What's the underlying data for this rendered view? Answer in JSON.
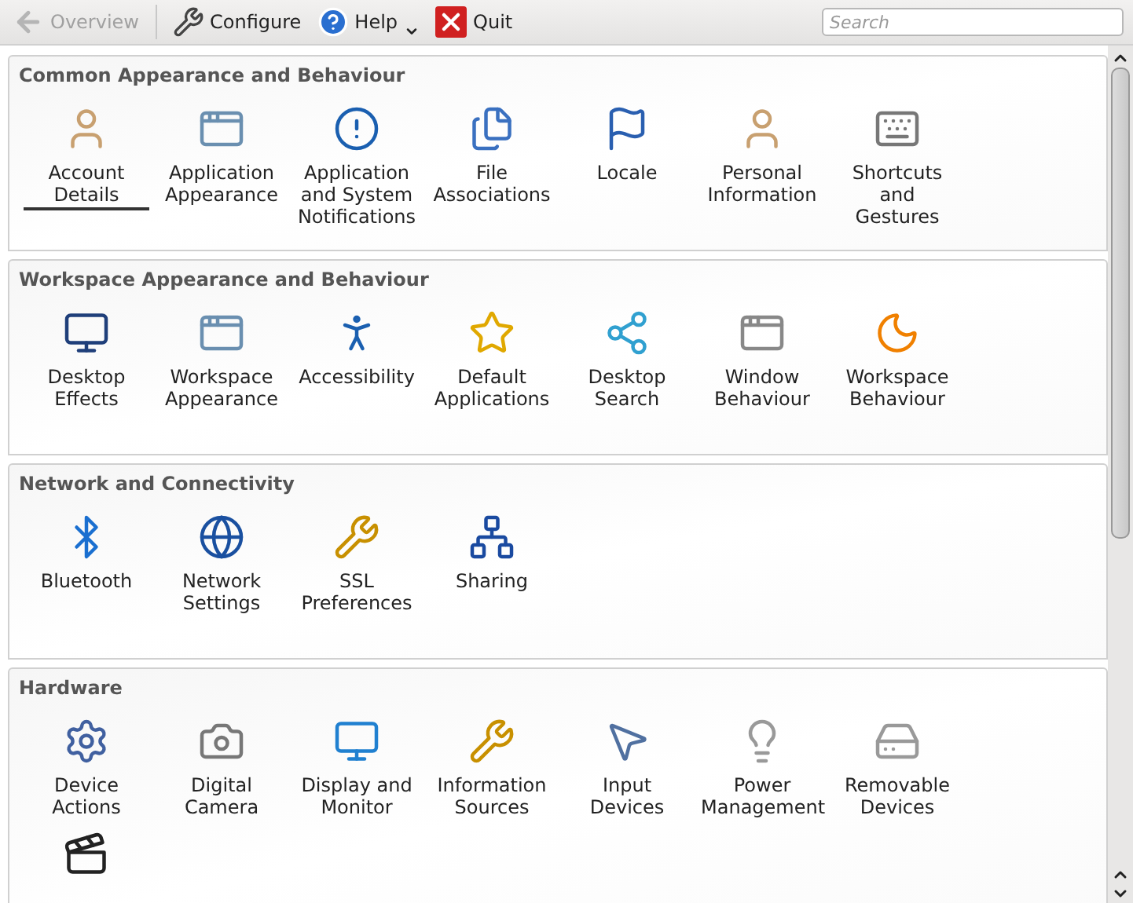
{
  "toolbar": {
    "overview": {
      "label": "Overview",
      "disabled": true
    },
    "configure": {
      "label": "Configure"
    },
    "help": {
      "label": "Help"
    },
    "quit": {
      "label": "Quit"
    },
    "search": {
      "placeholder": "Search"
    }
  },
  "sections": [
    {
      "title": "Common Appearance and Behaviour",
      "items": [
        {
          "label": "Account Details",
          "selected": true
        },
        {
          "label": "Application Appearance",
          "selected": false
        },
        {
          "label": "Application and System Notifications",
          "selected": false
        },
        {
          "label": "File Associations",
          "selected": false
        },
        {
          "label": "Locale",
          "selected": false
        },
        {
          "label": "Personal Information",
          "selected": false
        },
        {
          "label": "Shortcuts and Gestures",
          "selected": false
        }
      ]
    },
    {
      "title": "Workspace Appearance and Behaviour",
      "items": [
        {
          "label": "Desktop Effects",
          "selected": false
        },
        {
          "label": "Workspace Appearance",
          "selected": false
        },
        {
          "label": "Accessibility",
          "selected": false
        },
        {
          "label": "Default Applications",
          "selected": false
        },
        {
          "label": "Desktop Search",
          "selected": false
        },
        {
          "label": "Window Behaviour",
          "selected": false
        },
        {
          "label": "Workspace Behaviour",
          "selected": false
        }
      ]
    },
    {
      "title": "Network and Connectivity",
      "items": [
        {
          "label": "Bluetooth",
          "selected": false
        },
        {
          "label": "Network Settings",
          "selected": false
        },
        {
          "label": "SSL Preferences",
          "selected": false
        },
        {
          "label": "Sharing",
          "selected": false
        }
      ]
    },
    {
      "title": "Hardware",
      "items": [
        {
          "label": "Device Actions",
          "selected": false
        },
        {
          "label": "Digital Camera",
          "selected": false
        },
        {
          "label": "Display and Monitor",
          "selected": false
        },
        {
          "label": "Information Sources",
          "selected": false
        },
        {
          "label": "Input Devices",
          "selected": false
        },
        {
          "label": "Power Management",
          "selected": false
        },
        {
          "label": "Removable Devices",
          "selected": false
        },
        {
          "selected": false
        }
      ]
    }
  ]
}
